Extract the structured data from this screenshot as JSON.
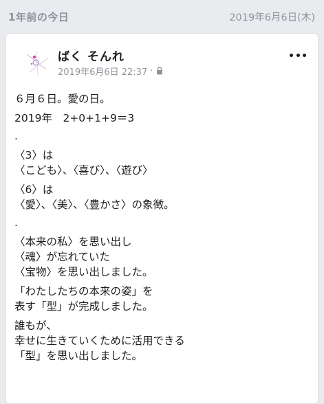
{
  "memory": {
    "title": "1年前の今日",
    "date": "2019年6月6日(木)"
  },
  "post": {
    "author": "ばく そんれ",
    "timestamp": "2019年6月6日 22:37",
    "separator": "·",
    "privacy_icon": "lock-icon",
    "menu_icon": "more-icon",
    "paragraphs": [
      "６月６日。愛の日。",
      "2019年　2+0+1+9＝3",
      ".",
      "〈3〉は\n〈こども〉、〈喜び〉、〈遊び〉",
      "〈6〉は\n〈愛〉、〈美〉、〈豊かさ〉の象徴。",
      ".",
      "〈本来の私〉を思い出し\n〈魂〉が忘れていた\n〈宝物〉を思い出しました。",
      "「わたしたちの本来の姿」を\n表す「型」が完成しました。",
      "誰もが、\n幸せに生きていくために活用できる\n「型」を思い出しました。"
    ]
  },
  "colors": {
    "background": "#e9ebee",
    "card": "#ffffff",
    "muted": "#90949c",
    "text": "#1c1e21",
    "avatar_accent": "#e040a0"
  }
}
